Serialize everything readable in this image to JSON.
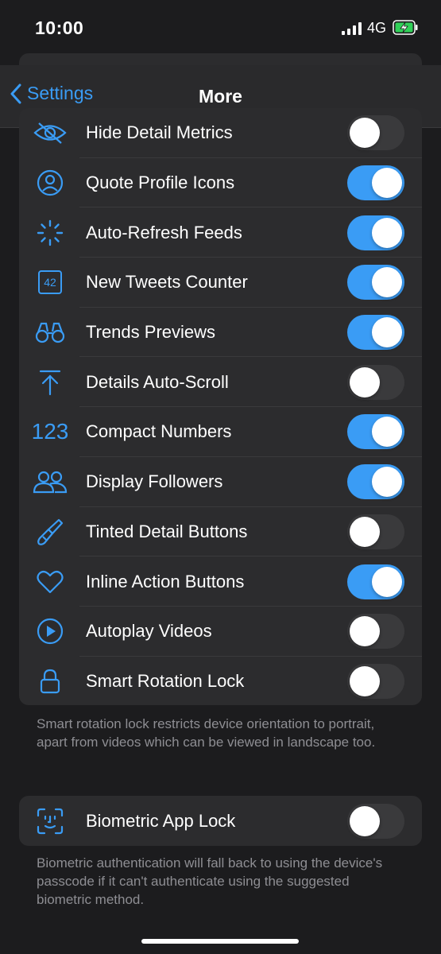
{
  "status_bar": {
    "time": "10:00",
    "network": "4G"
  },
  "nav": {
    "back_label": "Settings",
    "title": "More"
  },
  "settings": [
    {
      "label": "Hide Detail Metrics",
      "icon": "eye-slash-icon",
      "on": false
    },
    {
      "label": "Quote Profile Icons",
      "icon": "person-circle-icon",
      "on": true
    },
    {
      "label": "Auto-Refresh Feeds",
      "icon": "spinner-icon",
      "on": true
    },
    {
      "label": "New Tweets Counter",
      "icon": "counter-42-icon",
      "on": true
    },
    {
      "label": "Trends Previews",
      "icon": "binoculars-icon",
      "on": true
    },
    {
      "label": "Details Auto-Scroll",
      "icon": "arrow-up-to-line-icon",
      "on": false
    },
    {
      "label": "Compact Numbers",
      "icon": "numbers-123-icon",
      "on": true
    },
    {
      "label": "Display Followers",
      "icon": "people-icon",
      "on": true
    },
    {
      "label": "Tinted Detail Buttons",
      "icon": "paintbrush-icon",
      "on": false
    },
    {
      "label": "Inline Action Buttons",
      "icon": "heart-icon",
      "on": true
    },
    {
      "label": "Autoplay Videos",
      "icon": "play-circle-icon",
      "on": false
    },
    {
      "label": "Smart Rotation Lock",
      "icon": "lock-icon",
      "on": false
    }
  ],
  "rotation_footnote": "Smart rotation lock restricts device orientation to portrait, apart from videos which can be viewed in landscape too.",
  "biometric": {
    "label": "Biometric App Lock",
    "icon": "face-id-icon",
    "on": false
  },
  "biometric_footnote": "Biometric authentication will fall back to using the device's passcode if it can't authenticate using the suggested biometric method.",
  "icon_text": {
    "counter": "42",
    "numbers": "123"
  },
  "colors": {
    "accent": "#3a9cf5",
    "background": "#1c1c1e",
    "cell": "#2c2c2e",
    "toggle_off": "#3a3a3c"
  }
}
